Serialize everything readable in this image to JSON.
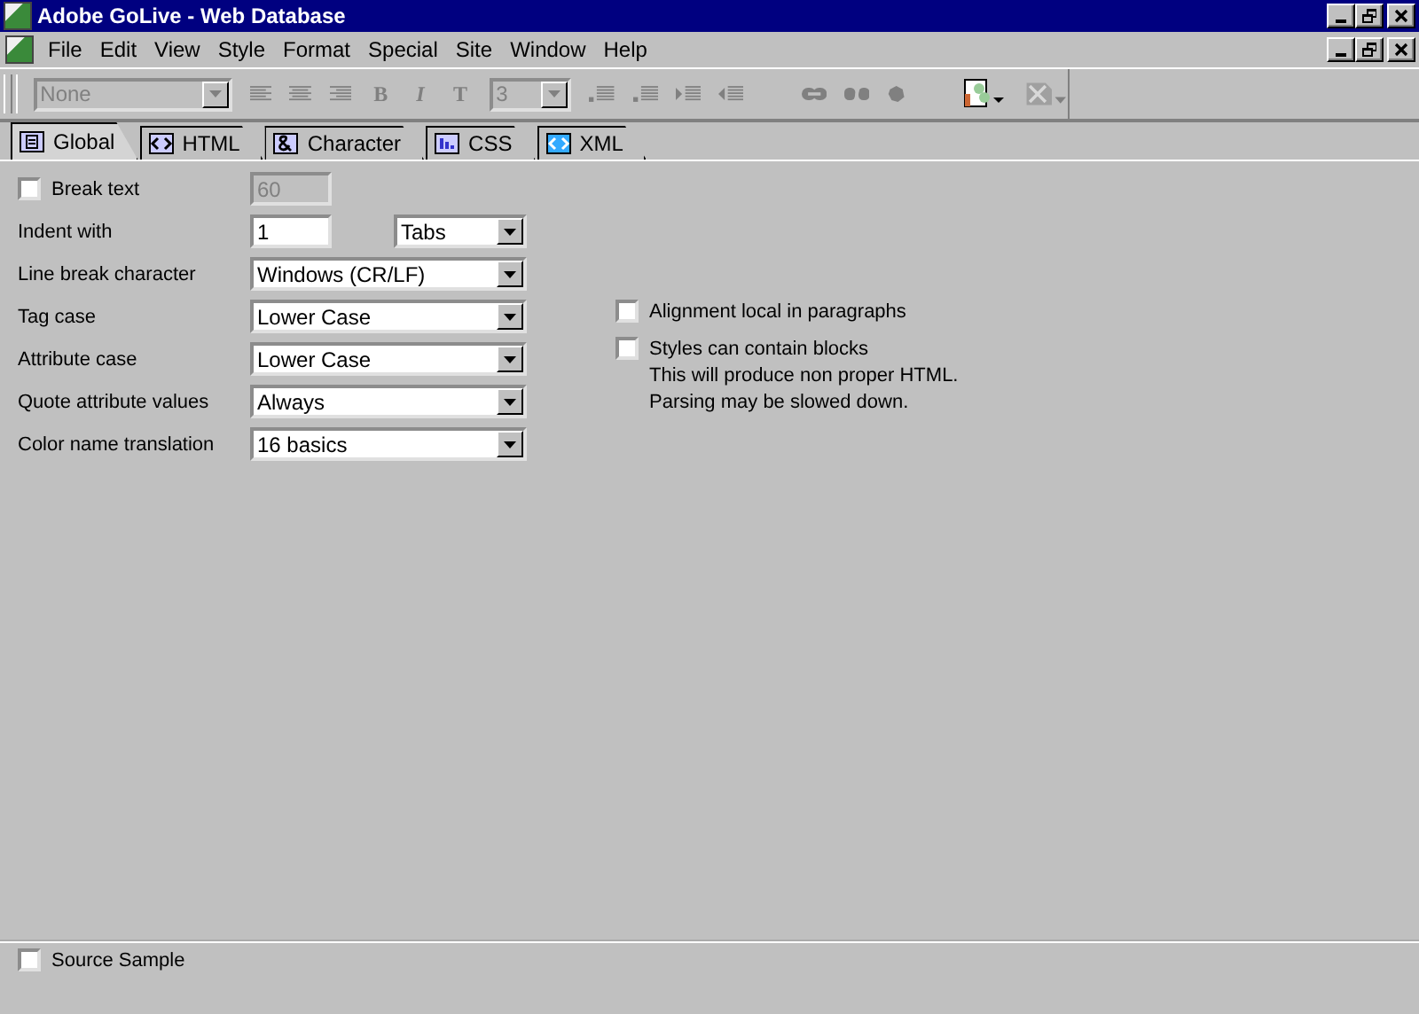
{
  "window": {
    "title": "Adobe GoLive - Web Database"
  },
  "menu": [
    "File",
    "Edit",
    "View",
    "Style",
    "Format",
    "Special",
    "Site",
    "Window",
    "Help"
  ],
  "toolbar": {
    "style_select": {
      "value": "None",
      "disabled": true
    },
    "format_buttons": [
      "B",
      "I",
      "T"
    ],
    "size_select": {
      "value": "3",
      "disabled": true
    }
  },
  "tabs": [
    {
      "label": "Global",
      "selected": true
    },
    {
      "label": "HTML",
      "selected": false
    },
    {
      "label": "Character",
      "selected": false
    },
    {
      "label": "CSS",
      "selected": false
    },
    {
      "label": "XML",
      "selected": false
    }
  ],
  "break_text": {
    "label": "Break text",
    "checked": false,
    "value": "60",
    "disabled": true
  },
  "indent": {
    "label": "Indent with",
    "value": "1",
    "unit": "Tabs"
  },
  "settings": [
    {
      "label": "Line break character",
      "value": "Windows (CR/LF)"
    },
    {
      "label": "Tag case",
      "value": "Lower Case"
    },
    {
      "label": "Attribute case",
      "value": "Lower Case"
    },
    {
      "label": "Quote attribute values",
      "value": "Always"
    },
    {
      "label": "Color name translation",
      "value": "16 basics"
    }
  ],
  "options": [
    {
      "label": "Alignment local in paragraphs",
      "checked": false
    },
    {
      "label": "Styles can contain blocks",
      "checked": false,
      "notes": [
        "This will produce non proper HTML.",
        "Parsing may be slowed down."
      ]
    }
  ],
  "source_sample": {
    "label": "Source Sample",
    "checked": false
  }
}
